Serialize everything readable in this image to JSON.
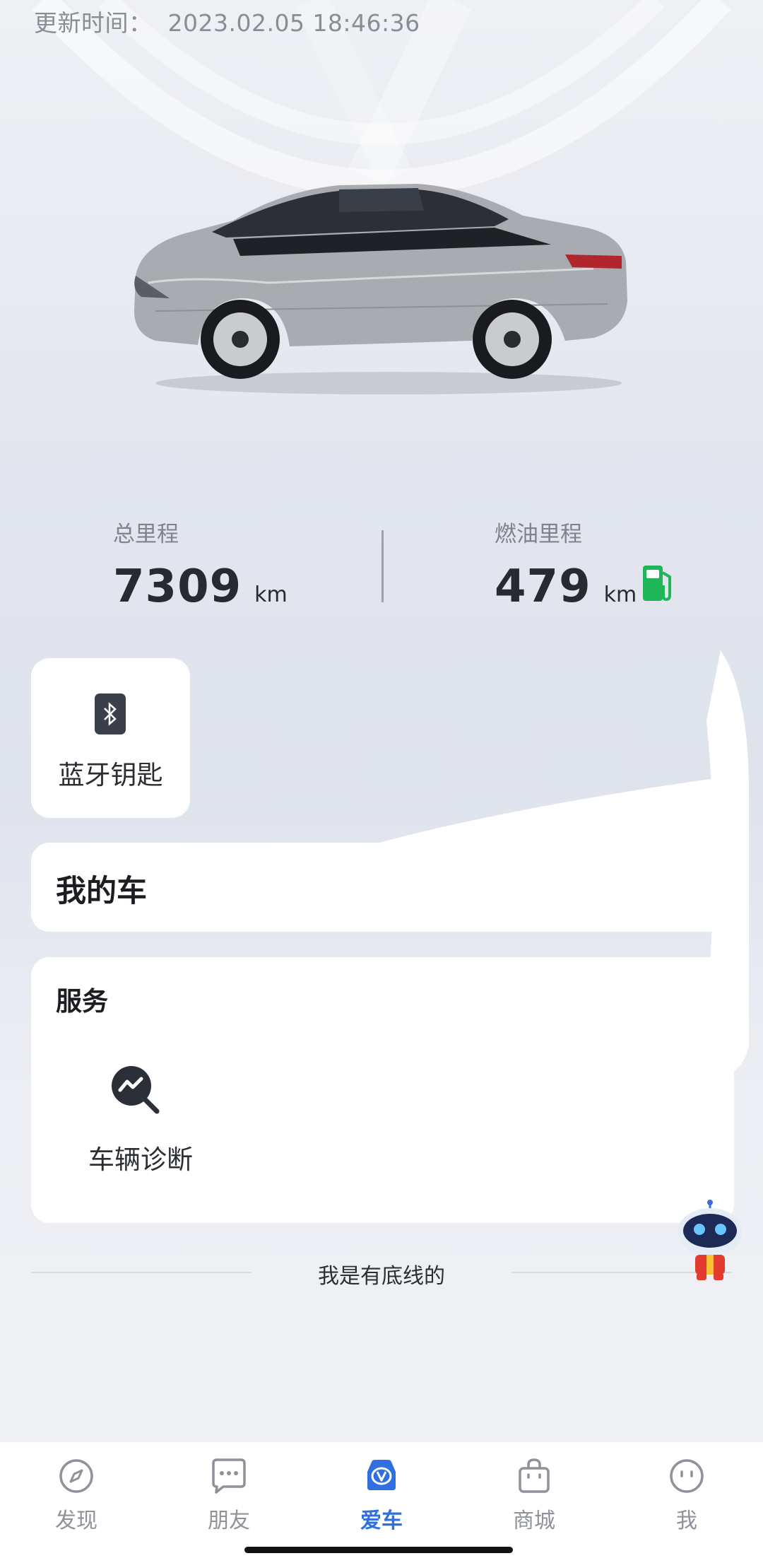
{
  "header": {
    "update_label": "更新时间：",
    "update_time": "2023.02.05 18:46:36"
  },
  "stats": {
    "total": {
      "label": "总里程",
      "value": "7309",
      "unit": "km"
    },
    "fuel": {
      "label": "燃油里程",
      "value": "479",
      "unit": "km"
    }
  },
  "cards": {
    "bluetooth_key": "蓝牙钥匙",
    "my_car": "我的车",
    "service_title": "服务",
    "diagnosis": "车辆诊断"
  },
  "footer_text": "我是有底线的",
  "tabs": [
    {
      "label": "发现",
      "icon": "compass-icon",
      "active": false
    },
    {
      "label": "朋友",
      "icon": "chat-icon",
      "active": false
    },
    {
      "label": "爱车",
      "icon": "car-v-icon",
      "active": true
    },
    {
      "label": "商城",
      "icon": "shopping-bag-icon",
      "active": false
    },
    {
      "label": "我",
      "icon": "face-icon",
      "active": false
    }
  ],
  "colors": {
    "accent": "#2f6fe0",
    "fuel_green": "#1fb65a",
    "tab_inactive": "#8f929a"
  }
}
